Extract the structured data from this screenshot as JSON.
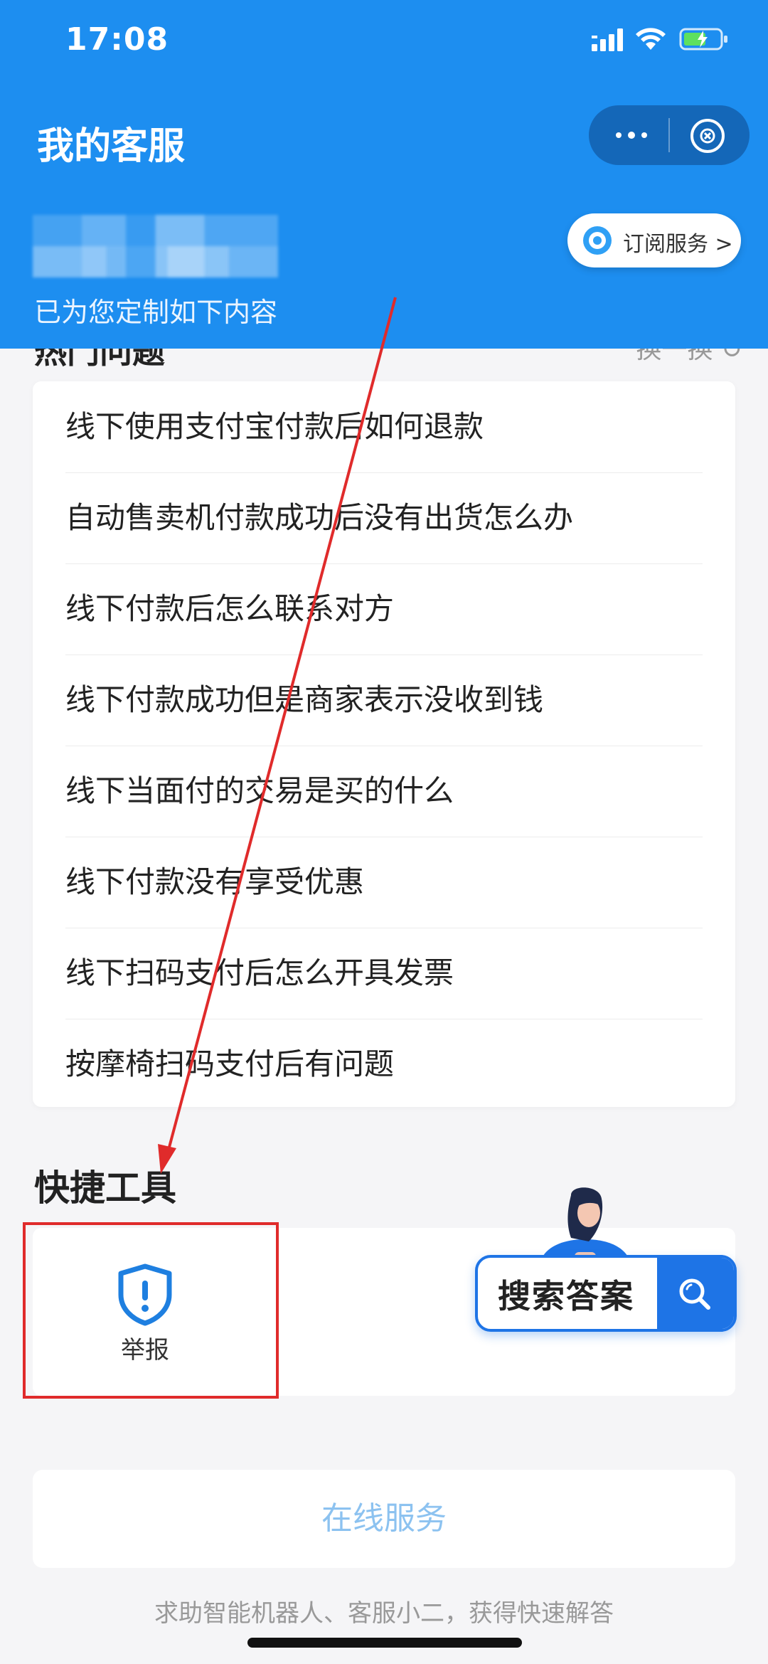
{
  "status_bar": {
    "time": "17:08"
  },
  "header": {
    "title": "我的客服",
    "subtitle": "已为您定制如下内容",
    "subscribe_label": "订阅服务 >"
  },
  "questions_section": {
    "items": [
      "线下使用支付宝付款后如何退款",
      "自动售卖机付款成功后没有出货怎么办",
      "线下付款后怎么联系对方",
      "线下付款成功但是商家表示没收到钱",
      "线下当面付的交易是买的什么",
      "线下付款没有享受优惠",
      "线下扫码支付后怎么开具发票",
      "按摩椅扫码支付后有问题"
    ]
  },
  "quick_tools": {
    "title": "快捷工具",
    "tools": [
      {
        "label": "举报",
        "icon": "shield-alert-icon"
      }
    ]
  },
  "search": {
    "label": "搜索答案",
    "icon": "search-icon"
  },
  "bottom": {
    "online_service_label": "在线服务",
    "help_text": "求助智能机器人、客服小二，获得快速解答"
  },
  "colors": {
    "header_bg": "#1d8ef0",
    "accent": "#1e74e6",
    "annotation": "#e02b2b"
  }
}
